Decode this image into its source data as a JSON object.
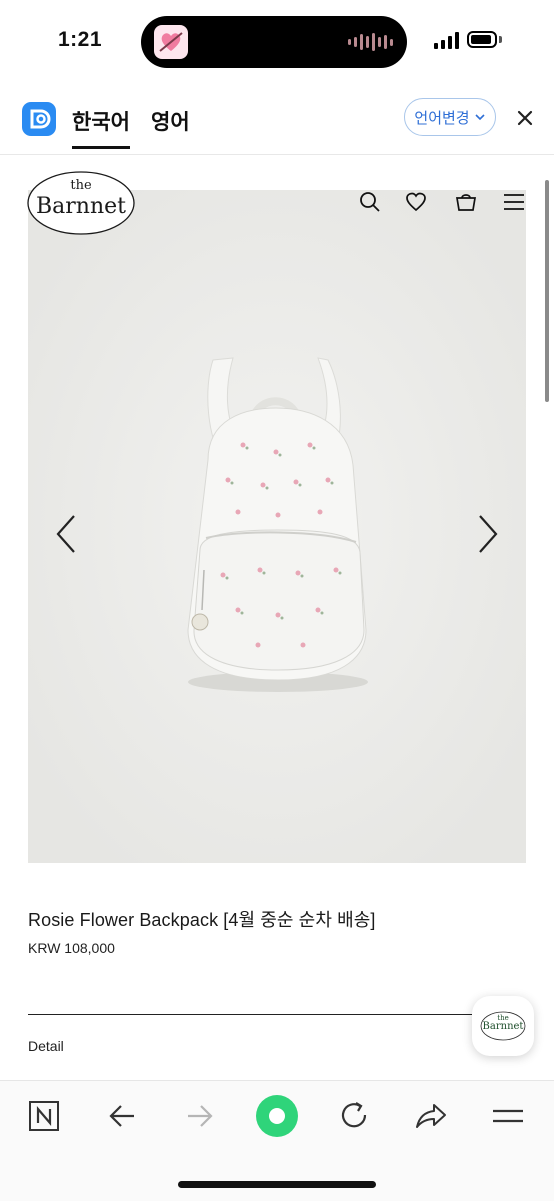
{
  "status_bar": {
    "time": "1:21"
  },
  "translate_bar": {
    "tabs": [
      {
        "label": "한국어",
        "active": true
      },
      {
        "label": "영어",
        "active": false
      }
    ],
    "change_language_label": "언어변경",
    "accent_color": "#2f6fd6"
  },
  "store": {
    "logo_text_top": "the",
    "logo_text_main": "Barnnet",
    "header_icons": [
      "search-icon",
      "heart-icon",
      "bag-icon",
      "menu-icon"
    ],
    "logo_color": "#1f4f2c"
  },
  "product": {
    "title": "Rosie Flower Backpack [4월 중순 순차 배송]",
    "price": "KRW 108,000",
    "detail_label": "Detail"
  },
  "floating_badge": {
    "text_top": "the",
    "text_main": "Barnnet"
  },
  "toolbar": {
    "buttons": [
      "naver-n-icon",
      "back-arrow-icon",
      "forward-arrow-icon",
      "green-dot-icon",
      "reload-icon",
      "share-icon",
      "menu-icon"
    ],
    "green": "#2fd47a"
  }
}
